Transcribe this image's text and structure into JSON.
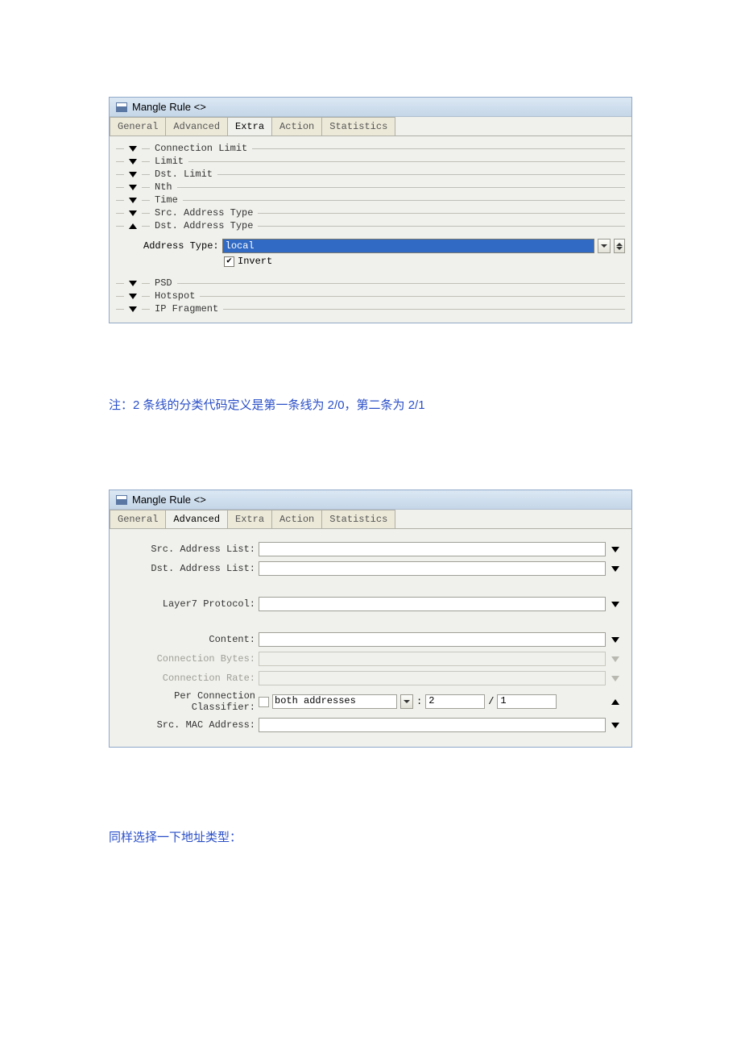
{
  "window1": {
    "title": "Mangle Rule <>",
    "tabs": [
      "General",
      "Advanced",
      "Extra",
      "Action",
      "Statistics"
    ],
    "activeTab": "Extra",
    "folds": [
      "Connection Limit",
      "Limit",
      "Dst. Limit",
      "Nth",
      "Time",
      "Src. Address Type",
      "Dst. Address Type",
      "PSD",
      "Hotspot",
      "IP Fragment"
    ],
    "addrTypeLabel": "Address Type:",
    "addrTypeValue": "local",
    "invertChecked": true,
    "invertLabel": "Invert"
  },
  "note1": "注：2 条线的分类代码定义是第一条线为 2/0，第二条为 2/1",
  "window2": {
    "title": "Mangle Rule <>",
    "tabs": [
      "General",
      "Advanced",
      "Extra",
      "Action",
      "Statistics"
    ],
    "activeTab": "Advanced",
    "rows": {
      "srcAddrList": "Src. Address List:",
      "dstAddrList": "Dst. Address List:",
      "layer7": "Layer7 Protocol:",
      "content": "Content:",
      "connBytes": "Connection Bytes:",
      "connRate": "Connection Rate:",
      "pcc": "Per Connection Classifier:",
      "pccSelect": "both addresses",
      "pccColon": ":",
      "pccNum1": "2",
      "pccSlash": "/",
      "pccNum2": "1",
      "srcMac": "Src. MAC Address:"
    }
  },
  "note2": "同样选择一下地址类型："
}
